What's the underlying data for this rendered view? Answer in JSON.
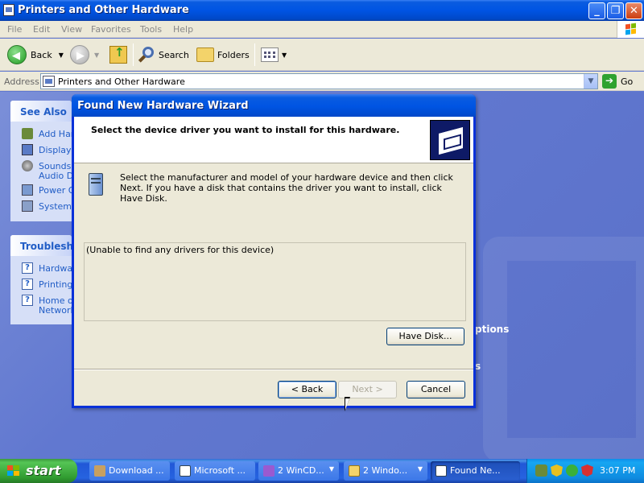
{
  "explorer": {
    "title": "Printers and Other Hardware",
    "menu": [
      "File",
      "Edit",
      "View",
      "Favorites",
      "Tools",
      "Help"
    ],
    "toolbar": {
      "back": "Back",
      "search": "Search",
      "folders": "Folders"
    },
    "address": {
      "label": "Address",
      "value": "Printers and Other Hardware",
      "go": "Go"
    },
    "see_also": {
      "header": "See Also",
      "items": [
        "Add Har",
        "Display",
        "Sounds,",
        "Audio De",
        "Power O",
        "System"
      ]
    },
    "troubleshooters": {
      "header": "Troublesho",
      "items": [
        "Hardwa",
        "Printing",
        "Home or",
        "Network"
      ]
    },
    "background_text": [
      "ptions",
      "s"
    ]
  },
  "wizard": {
    "title": "Found New Hardware Wizard",
    "heading": "Select the device driver you want to install for this hardware.",
    "instructions": "Select the manufacturer and model of your hardware device and then click Next. If you have a disk that contains the driver you want to install, click Have Disk.",
    "driver_list_message": "(Unable to find any drivers for this device)",
    "have_disk": "Have Disk...",
    "back": "< Back",
    "next": "Next >",
    "cancel": "Cancel"
  },
  "taskbar": {
    "start": "start",
    "tasks": [
      {
        "label": "Download ..."
      },
      {
        "label": "Microsoft ..."
      },
      {
        "label": "2 WinCD..."
      },
      {
        "label": "2 Windo..."
      },
      {
        "label": "Found Ne..."
      }
    ],
    "clock": "3:07 PM"
  }
}
